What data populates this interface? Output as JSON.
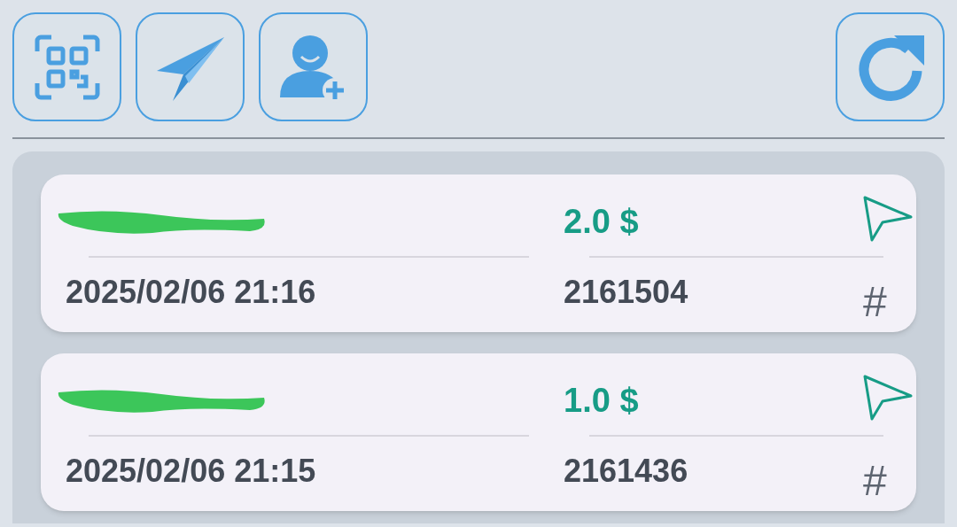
{
  "toolbar": [
    {
      "kind": "qr"
    },
    {
      "kind": "send"
    },
    {
      "kind": "add-user"
    }
  ],
  "refresh": {
    "kind": "refresh"
  },
  "transactions": [
    {
      "name_redacted": true,
      "amount": "2.0 $",
      "date": "2025/02/06 21:16",
      "number": "2161504",
      "hash": "#"
    },
    {
      "name_redacted": true,
      "amount": "1.0 $",
      "date": "2025/02/06 21:15",
      "number": "2161436",
      "hash": "#"
    }
  ]
}
